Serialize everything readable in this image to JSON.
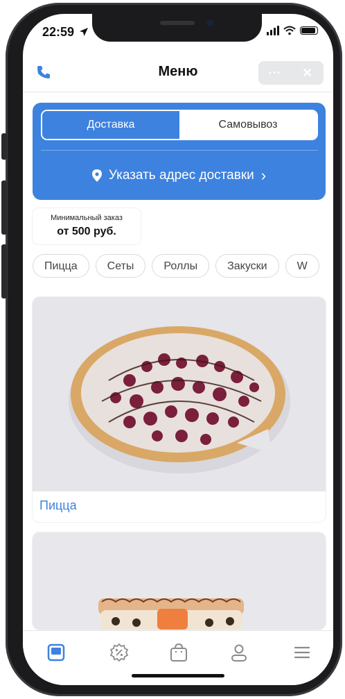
{
  "status": {
    "time": "22:59"
  },
  "header": {
    "title": "Меню",
    "more_label": "···",
    "close_label": "✕"
  },
  "delivery": {
    "tab_delivery": "Доставка",
    "tab_pickup": "Самовывоз",
    "address_label": "Указать адрес доставки",
    "address_chevron": "›"
  },
  "min_order": {
    "label": "Минимальный заказ",
    "value": "от 500 руб."
  },
  "categories": [
    "Пицца",
    "Сеты",
    "Роллы",
    "Закуски",
    "W"
  ],
  "cards": [
    {
      "caption": "Пицца"
    }
  ],
  "colors": {
    "accent": "#3d82df",
    "background": "#ffffff",
    "text": "#111111"
  },
  "icons": {
    "header_left": "phone-icon",
    "tabbar": [
      "menu-icon",
      "percent-badge-icon",
      "shopping-bag-icon",
      "profile-icon",
      "hamburger-icon"
    ]
  }
}
